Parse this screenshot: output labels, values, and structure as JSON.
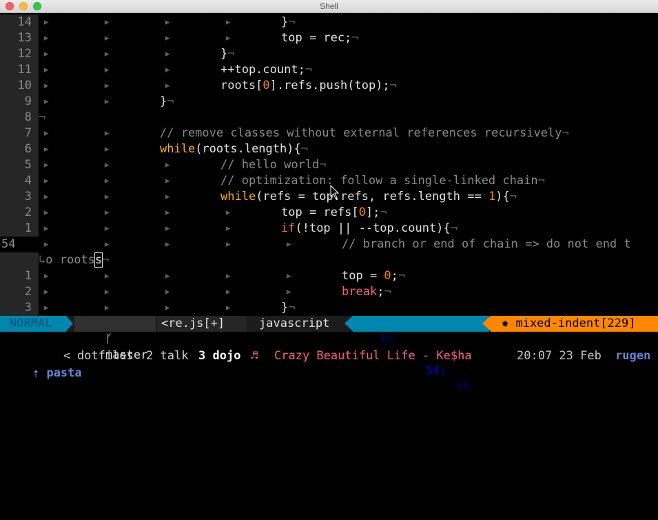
{
  "window": {
    "title": "Shell"
  },
  "editor": {
    "lines": [
      {
        "num": "14",
        "indent": 4,
        "tokens": [
          {
            "t": "}",
            "c": ""
          }
        ]
      },
      {
        "num": "13",
        "indent": 4,
        "tokens": [
          {
            "t": "top = rec;",
            "c": ""
          }
        ]
      },
      {
        "num": "12",
        "indent": 3,
        "tokens": [
          {
            "t": "}",
            "c": ""
          }
        ]
      },
      {
        "num": "11",
        "indent": 3,
        "tokens": [
          {
            "t": "++top.count;",
            "c": ""
          }
        ]
      },
      {
        "num": "10",
        "indent": 3,
        "tokens": [
          {
            "t": "roots[",
            "c": ""
          },
          {
            "t": "0",
            "c": "num"
          },
          {
            "t": "].refs.push(top);",
            "c": ""
          }
        ]
      },
      {
        "num": "9",
        "indent": 2,
        "tokens": [
          {
            "t": "}",
            "c": ""
          }
        ]
      },
      {
        "num": "8",
        "indent": 0,
        "tokens": []
      },
      {
        "num": "7",
        "indent": 2,
        "tokens": [
          {
            "t": "// remove classes without external references recursively",
            "c": "cmt"
          }
        ]
      },
      {
        "num": "6",
        "indent": 2,
        "tokens": [
          {
            "t": "while",
            "c": "kw"
          },
          {
            "t": "(roots.length){",
            "c": ""
          }
        ]
      },
      {
        "num": "5",
        "indent": 3,
        "tokens": [
          {
            "t": "// hello world",
            "c": "cmt"
          }
        ]
      },
      {
        "num": "4",
        "indent": 3,
        "tokens": [
          {
            "t": "// optimization: follow a single-linked chain",
            "c": "cmt"
          }
        ]
      },
      {
        "num": "3",
        "indent": 3,
        "tokens": [
          {
            "t": "while",
            "c": "kw"
          },
          {
            "t": "(refs = top.refs, refs.length == ",
            "c": ""
          },
          {
            "t": "1",
            "c": "num"
          },
          {
            "t": "){",
            "c": ""
          }
        ]
      },
      {
        "num": "2",
        "indent": 4,
        "tokens": [
          {
            "t": "top = refs[",
            "c": ""
          },
          {
            "t": "0",
            "c": "num"
          },
          {
            "t": "];",
            "c": ""
          }
        ]
      },
      {
        "num": "1",
        "indent": 4,
        "tokens": [
          {
            "t": "if",
            "c": "ctl"
          },
          {
            "t": "(!top || --top.count){",
            "c": ""
          }
        ]
      },
      {
        "num": "54",
        "indent": 5,
        "current": true,
        "noeol": true,
        "tokens": [
          {
            "t": "// branch or end of chain => do not end t",
            "c": "cmt"
          }
        ]
      },
      {
        "num": "",
        "wrapped": true,
        "tokens": [
          {
            "t": "o roots",
            "c": "cmt"
          },
          {
            "t": "|",
            "c": "cursor"
          }
        ]
      },
      {
        "num": "1",
        "indent": 5,
        "tokens": [
          {
            "t": "top = ",
            "c": ""
          },
          {
            "t": "0",
            "c": "num"
          },
          {
            "t": ";",
            "c": ""
          }
        ]
      },
      {
        "num": "2",
        "indent": 5,
        "tokens": [
          {
            "t": "break",
            "c": "ctl"
          },
          {
            "t": ";",
            "c": ""
          }
        ]
      },
      {
        "num": "3",
        "indent": 4,
        "tokens": [
          {
            "t": "}",
            "c": ""
          }
        ]
      }
    ],
    "tab_glyph": "▸",
    "eol_glyph": "¬",
    "wrap_glyph": "↳"
  },
  "statusline": {
    "mode": "NORMAL",
    "branch_icon": "ᚴ",
    "branch": "master",
    "file": "<re.js[+]",
    "filetype": "javascript",
    "percent": "4%",
    "line_icon": "␤",
    "line": "54:",
    "column": "89",
    "warning": "✹ mixed-indent[229]"
  },
  "tmux": {
    "session_icon": "⇡",
    "session": "pasta",
    "lt": "<",
    "window1": "dotfiles",
    "window2_num": "2",
    "window2": "talk",
    "window3_num": "3",
    "window3": "dojo",
    "music_icon": "♬",
    "song": "Crazy Beautiful Life - Ke$ha",
    "time": "20:07 23 Feb",
    "host": "rugen"
  },
  "colors": {
    "keyword": "#ffaf00",
    "control": "#ff5f87",
    "number": "#ff8700",
    "comment": "#8a8a8a",
    "mode_bg": "#0087af",
    "warning_bg": "#ff8700"
  }
}
